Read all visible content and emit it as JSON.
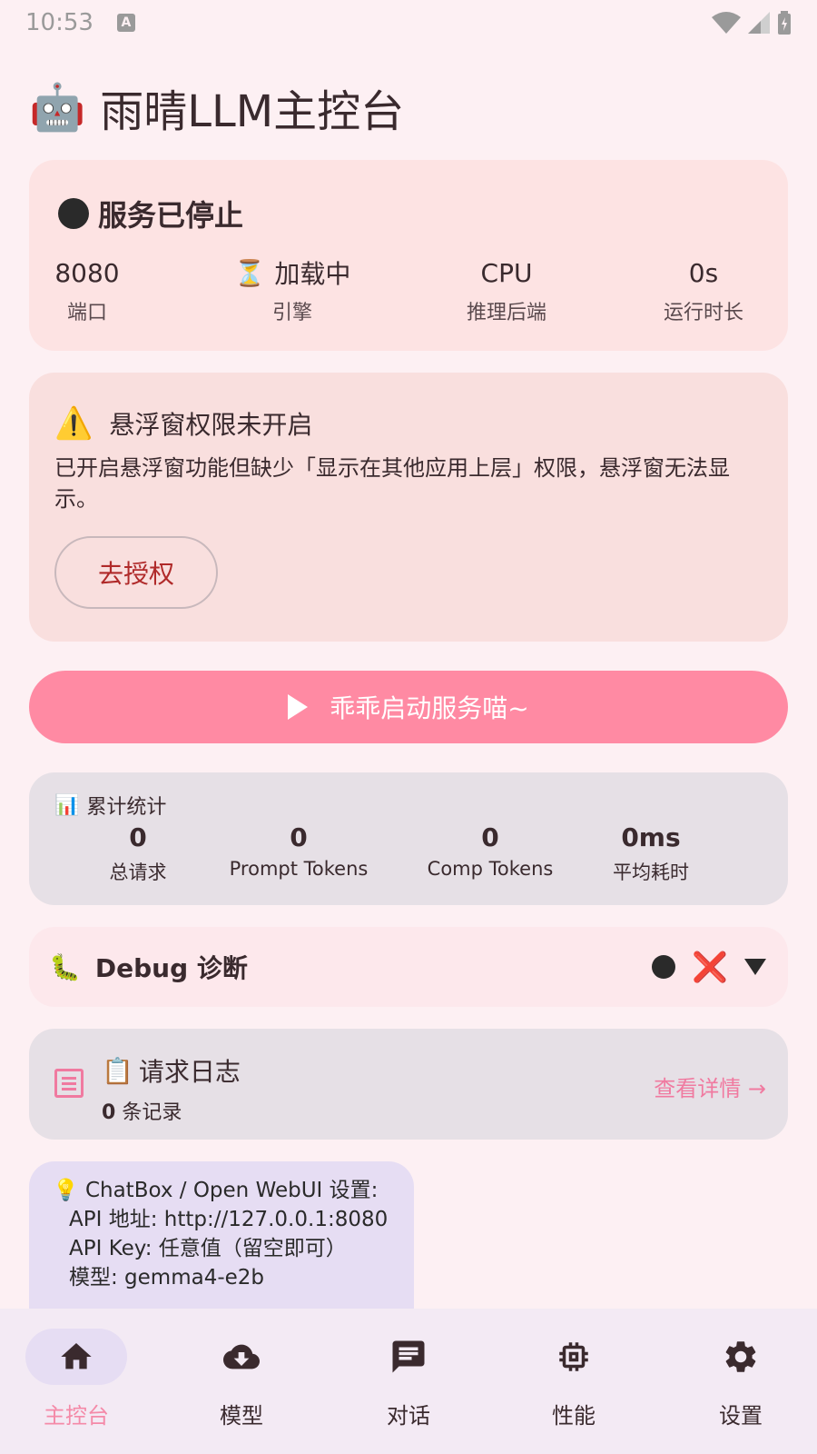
{
  "status_bar": {
    "time": "10:53",
    "notif_icon": "A"
  },
  "app": {
    "robot_icon": "🤖",
    "title": "雨晴LLM主控台"
  },
  "service": {
    "status_icon": "status-dot-icon",
    "status_text": "服务已停止",
    "stats": [
      {
        "value": "8080",
        "label": "端口"
      },
      {
        "icon": "⏳",
        "value": "加载中",
        "label": "引擎"
      },
      {
        "value": "CPU",
        "label": "推理后端"
      },
      {
        "value": "0s",
        "label": "运行时长"
      }
    ]
  },
  "warning": {
    "icon": "⚠️",
    "title": "悬浮窗权限未开启",
    "body": "已开启悬浮窗功能但缺少「显示在其他应用上层」权限，悬浮窗无法显示。",
    "button": "去授权"
  },
  "start_button": {
    "label": "乖乖启动服务喵~"
  },
  "cumulative": {
    "icon": "📊",
    "title": "累计统计",
    "items": [
      {
        "value": "0",
        "label": "总请求"
      },
      {
        "value": "0",
        "label": "Prompt Tokens"
      },
      {
        "value": "0",
        "label": "Comp Tokens"
      },
      {
        "value": "0ms",
        "label": "平均耗时"
      }
    ]
  },
  "debug": {
    "icon": "🐛",
    "title": "Debug 诊断",
    "x_mark": "❌"
  },
  "request_log": {
    "icon": "📋",
    "title": "请求日志",
    "count": "0",
    "count_suffix": "条记录",
    "link": "查看详情 →"
  },
  "tip": {
    "icon": "💡",
    "line1": "ChatBox / Open WebUI 设置:",
    "line2": "API 地址: http://127.0.0.1:8080",
    "line3": "API Key: 任意值（留空即可）",
    "line4": "模型: gemma4-e2b"
  },
  "nav": [
    {
      "label": "主控台",
      "icon": "home-icon",
      "active": true
    },
    {
      "label": "模型",
      "icon": "cloud-download-icon"
    },
    {
      "label": "对话",
      "icon": "chat-icon"
    },
    {
      "label": "性能",
      "icon": "chip-icon"
    },
    {
      "label": "设置",
      "icon": "gear-icon"
    }
  ],
  "colors": {
    "accent": "#ff8aa3",
    "background": "#fdf0f3",
    "service_card": "#fde3e3",
    "warning_card": "#f9dfde",
    "stats_card": "#e6e0e6",
    "tip_card": "#e6ddf3",
    "nav_bar": "#f3eaf4",
    "link": "#f07aa0"
  }
}
